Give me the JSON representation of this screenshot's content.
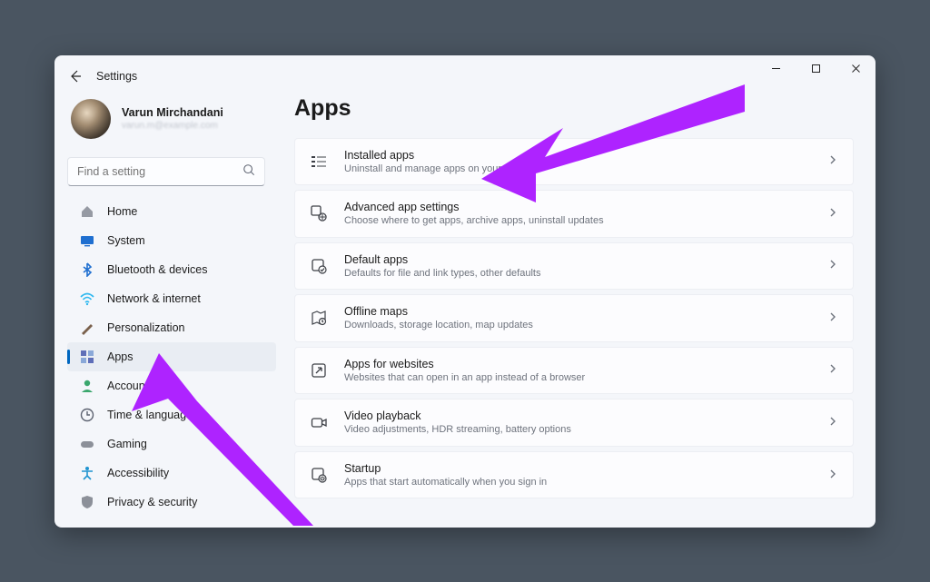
{
  "header": {
    "app_title": "Settings"
  },
  "profile": {
    "name": "Varun Mirchandani",
    "sub": "varun.m@example.com"
  },
  "search": {
    "placeholder": "Find a setting"
  },
  "sidebar": {
    "items": [
      {
        "label": "Home",
        "icon": "home-icon",
        "color": "#8c9099"
      },
      {
        "label": "System",
        "icon": "system-icon",
        "color": "#1f6fd0"
      },
      {
        "label": "Bluetooth & devices",
        "icon": "bluetooth-icon",
        "color": "#1f6fd0"
      },
      {
        "label": "Network & internet",
        "icon": "network-icon",
        "color": "#2fb8ef"
      },
      {
        "label": "Personalization",
        "icon": "personalization-icon",
        "color": "#7a614c"
      },
      {
        "label": "Apps",
        "icon": "apps-icon",
        "color": "#5e6eb8",
        "active": true
      },
      {
        "label": "Accounts",
        "icon": "accounts-icon",
        "color": "#3aa76d"
      },
      {
        "label": "Time & language",
        "icon": "time-icon",
        "color": "#5c6270"
      },
      {
        "label": "Gaming",
        "icon": "gaming-icon",
        "color": "#8c9099"
      },
      {
        "label": "Accessibility",
        "icon": "accessibility-icon",
        "color": "#1f94d0"
      },
      {
        "label": "Privacy & security",
        "icon": "privacy-icon",
        "color": "#8c9099"
      }
    ]
  },
  "page": {
    "title": "Apps"
  },
  "cards": [
    {
      "title": "Installed apps",
      "sub": "Uninstall and manage apps on your PC",
      "icon": "installed-apps-icon"
    },
    {
      "title": "Advanced app settings",
      "sub": "Choose where to get apps, archive apps, uninstall updates",
      "icon": "advanced-app-settings-icon"
    },
    {
      "title": "Default apps",
      "sub": "Defaults for file and link types, other defaults",
      "icon": "default-apps-icon"
    },
    {
      "title": "Offline maps",
      "sub": "Downloads, storage location, map updates",
      "icon": "offline-maps-icon"
    },
    {
      "title": "Apps for websites",
      "sub": "Websites that can open in an app instead of a browser",
      "icon": "apps-websites-icon"
    },
    {
      "title": "Video playback",
      "sub": "Video adjustments, HDR streaming, battery options",
      "icon": "video-playback-icon"
    },
    {
      "title": "Startup",
      "sub": "Apps that start automatically when you sign in",
      "icon": "startup-icon"
    }
  ],
  "annotation": {
    "color": "#ae23ff"
  }
}
